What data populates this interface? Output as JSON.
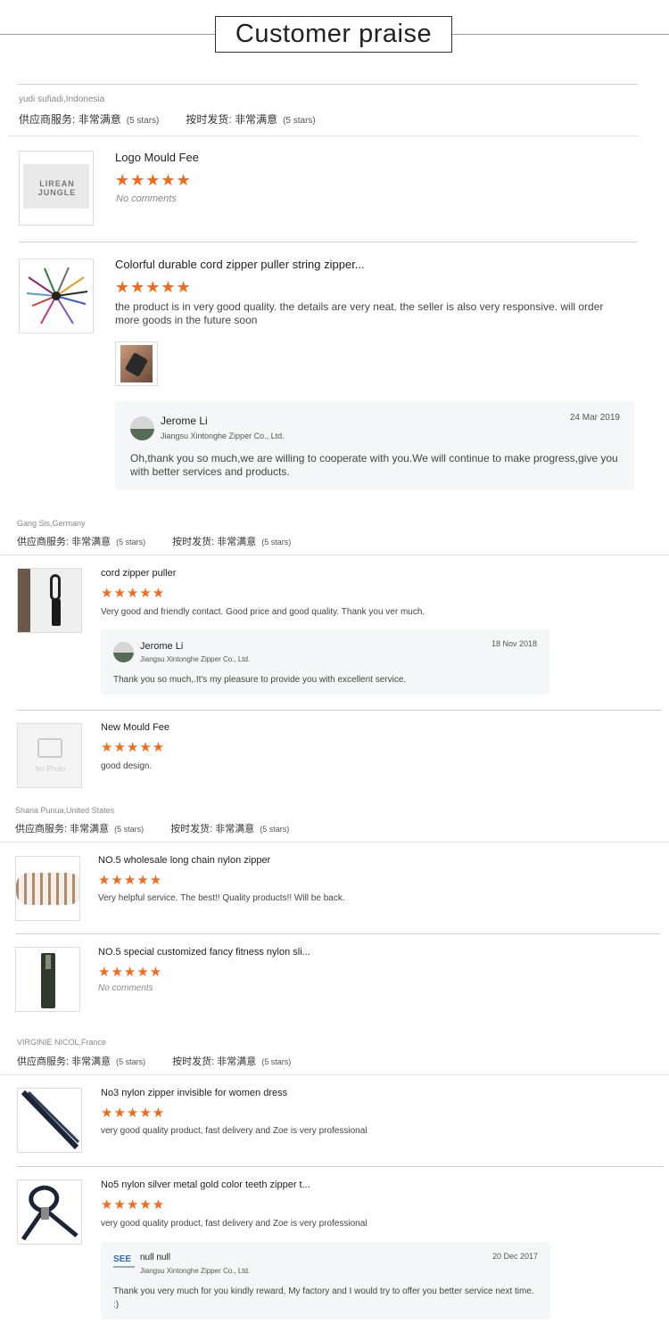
{
  "header": {
    "title": "Customer praise"
  },
  "labels": {
    "supplier_service": "供应商服务:",
    "on_time": "按时发货:",
    "very_satisfied": "非常满意",
    "five_stars": "(5 stars)"
  },
  "colors": {
    "star": "#f26b1d",
    "reply_bg": "#f5f6f8"
  },
  "reviews": [
    {
      "reviewer": "yudi sufiadi,Indonesia",
      "items": [
        {
          "title": "Logo Mould Fee",
          "rating": 5,
          "comment": "No comments",
          "thumb_text": "LIREAN JUNGLE"
        },
        {
          "title": "Colorful durable cord zipper puller string zipper...",
          "rating": 5,
          "comment": "the product is in very good quality. the details are very neat. the seller is also very responsive. will order more goods in the future soon",
          "reply": {
            "name": "Jerome Li",
            "company": "Jiangsu Xintonghe Zipper Co., Ltd.",
            "date": "24 Mar 2019",
            "text": "Oh,thank you so much,we are willing to cooperate with you.We will continue to make progress,give you with better services and products."
          }
        }
      ]
    },
    {
      "reviewer": "Gang Sis,Germany",
      "items": [
        {
          "title": "cord zipper puller",
          "rating": 5,
          "comment": "Very good and friendly contact. Good price and good quality. Thank you ver much.",
          "reply": {
            "name": "Jerome Li",
            "company": "Jiangsu Xintonghe Zipper Co., Ltd.",
            "date": "18 Nov 2018",
            "text": "Thank you so much,.It's my pleasure to provide you with excellent service."
          }
        },
        {
          "title": "New Mould Fee",
          "rating": 5,
          "comment": "good design.",
          "thumb_text": "No Photo"
        }
      ]
    },
    {
      "reviewer": "Shana Punua,United States",
      "items": [
        {
          "title": "NO.5 wholesale long chain nylon zipper",
          "rating": 5,
          "comment": "Very helpful service. The best!!  Quality products!!  Will be back."
        },
        {
          "title": "NO.5 special customized fancy fitness nylon sli...",
          "rating": 5,
          "comment": "No comments"
        }
      ]
    },
    {
      "reviewer": "VIRGINIE NICOL,France",
      "items": [
        {
          "title": "No3 nylon zipper invisible for women dress",
          "rating": 5,
          "comment": "very good quality product, fast delivery and Zoe is very professional"
        },
        {
          "title": "No5 nylon silver metal gold color teeth zipper t...",
          "rating": 5,
          "comment": "very good quality product, fast delivery and Zoe is very professional",
          "reply": {
            "name": "null null",
            "company": "Jiangsu Xintonghe Zipper Co., Ltd.",
            "date": "20 Dec 2017",
            "logo_text": "SEE",
            "text": "Thank you very much for you kindly reward, My factory and I would try to offer you better service next time. :)"
          }
        }
      ]
    }
  ]
}
